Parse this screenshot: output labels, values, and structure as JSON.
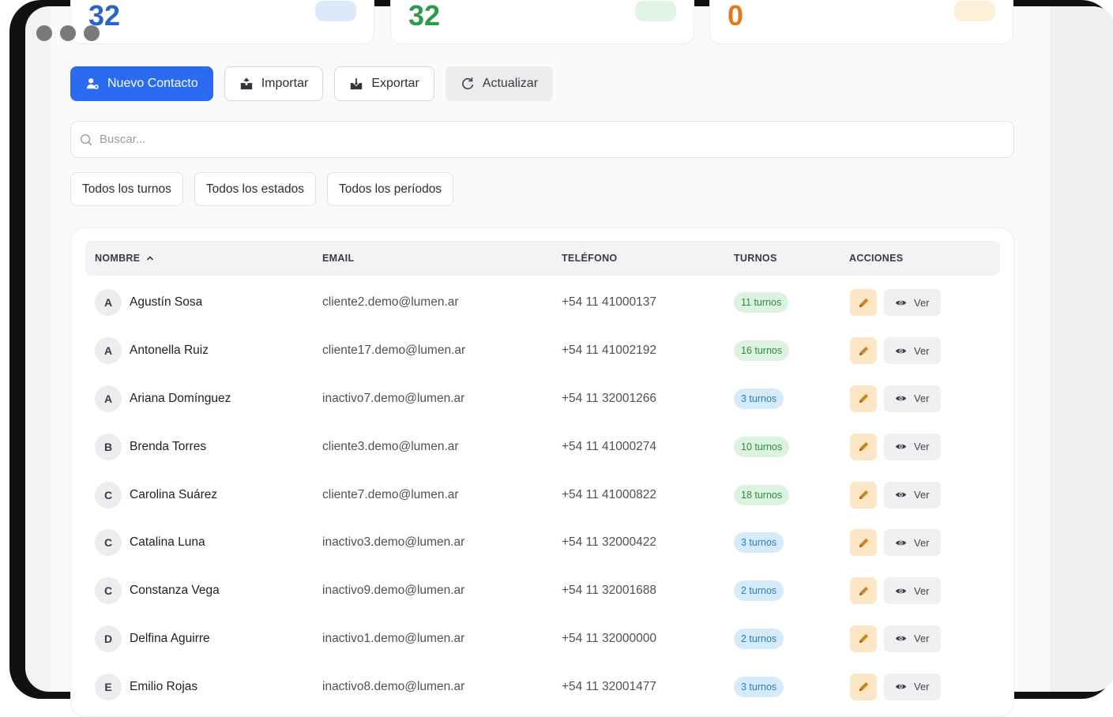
{
  "stats": [
    {
      "value": "32",
      "color": "#2a64c9",
      "pill_color": "#dbe9fb"
    },
    {
      "value": "32",
      "color": "#2e9a4a",
      "pill_color": "#e0f5e4"
    },
    {
      "value": "0",
      "color": "#e07a1f",
      "pill_color": "#fdf0d8"
    }
  ],
  "toolbar": {
    "new_contact": "Nuevo Contacto",
    "import": "Importar",
    "export": "Exportar",
    "refresh": "Actualizar"
  },
  "search": {
    "placeholder": "Buscar..."
  },
  "filters": {
    "shifts": "Todos los turnos",
    "states": "Todos los estados",
    "periods": "Todos los períodos"
  },
  "table": {
    "headers": {
      "name": "NOMBRE",
      "email": "EMAIL",
      "phone": "TELÉFONO",
      "shifts": "TURNOS",
      "actions": "ACCIONES"
    },
    "view_label": "Ver",
    "rows": [
      {
        "initial": "A",
        "name": "Agustín Sosa",
        "email": "cliente2.demo@lumen.ar",
        "phone": "+54 11 41000137",
        "turnos": "11 turnos",
        "badge": "green"
      },
      {
        "initial": "A",
        "name": "Antonella Ruiz",
        "email": "cliente17.demo@lumen.ar",
        "phone": "+54 11 41002192",
        "turnos": "16 turnos",
        "badge": "green"
      },
      {
        "initial": "A",
        "name": "Ariana Domínguez",
        "email": "inactivo7.demo@lumen.ar",
        "phone": "+54 11 32001266",
        "turnos": "3 turnos",
        "badge": "blue"
      },
      {
        "initial": "B",
        "name": "Brenda Torres",
        "email": "cliente3.demo@lumen.ar",
        "phone": "+54 11 41000274",
        "turnos": "10 turnos",
        "badge": "green"
      },
      {
        "initial": "C",
        "name": "Carolina Suárez",
        "email": "cliente7.demo@lumen.ar",
        "phone": "+54 11 41000822",
        "turnos": "18 turnos",
        "badge": "green"
      },
      {
        "initial": "C",
        "name": "Catalina Luna",
        "email": "inactivo3.demo@lumen.ar",
        "phone": "+54 11 32000422",
        "turnos": "3 turnos",
        "badge": "blue"
      },
      {
        "initial": "C",
        "name": "Constanza Vega",
        "email": "inactivo9.demo@lumen.ar",
        "phone": "+54 11 32001688",
        "turnos": "2 turnos",
        "badge": "blue"
      },
      {
        "initial": "D",
        "name": "Delfina Aguirre",
        "email": "inactivo1.demo@lumen.ar",
        "phone": "+54 11 32000000",
        "turnos": "2 turnos",
        "badge": "blue"
      },
      {
        "initial": "E",
        "name": "Emilio Rojas",
        "email": "inactivo8.demo@lumen.ar",
        "phone": "+54 11 32001477",
        "turnos": "3 turnos",
        "badge": "blue"
      }
    ]
  }
}
